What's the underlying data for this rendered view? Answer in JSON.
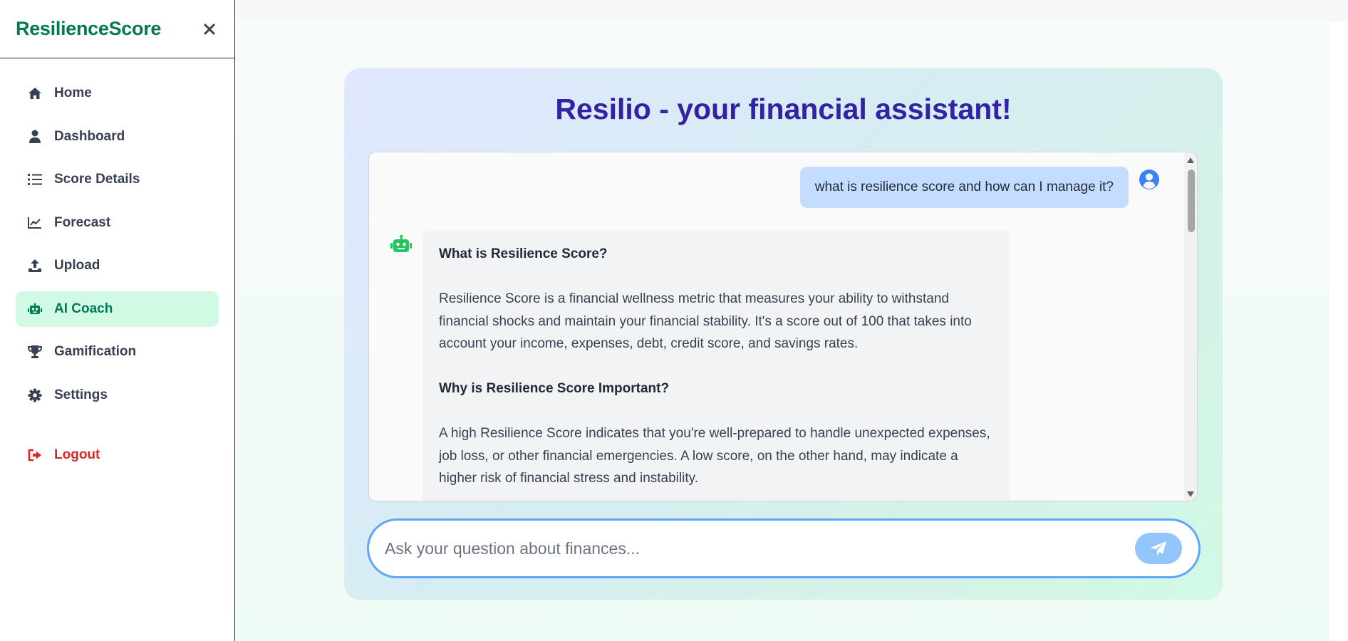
{
  "sidebar": {
    "brand": "ResilienceScore",
    "close_icon": "close-icon",
    "items": [
      {
        "label": "Home",
        "icon": "home-icon"
      },
      {
        "label": "Dashboard",
        "icon": "user-icon"
      },
      {
        "label": "Score Details",
        "icon": "list-icon"
      },
      {
        "label": "Forecast",
        "icon": "line-chart-icon"
      },
      {
        "label": "Upload",
        "icon": "upload-icon"
      },
      {
        "label": "AI Coach",
        "icon": "robot-icon",
        "active": true
      },
      {
        "label": "Gamification",
        "icon": "trophy-icon"
      },
      {
        "label": "Settings",
        "icon": "gear-icon"
      }
    ],
    "logout": {
      "label": "Logout",
      "icon": "logout-icon"
    }
  },
  "chat": {
    "title": "Resilio - your financial assistant!",
    "user_message": "what is resilience score and how can I manage it?",
    "bot_message": {
      "heading1": "What is Resilience Score?",
      "para1": "Resilience Score is a financial wellness metric that measures your ability to withstand financial shocks and maintain your financial stability. It's a score out of 100 that takes into account your income, expenses, debt, credit score, and savings rates.",
      "heading2": "Why is Resilience Score Important?",
      "para2": "A high Resilience Score indicates that you're well-prepared to handle unexpected expenses, job loss, or other financial emergencies. A low score, on the other hand, may indicate a higher risk of financial stress and instability."
    },
    "input_placeholder": "Ask your question about finances...",
    "send_icon": "send-icon"
  },
  "colors": {
    "brand": "#047857",
    "active_bg": "#d1fae5",
    "logout": "#dc2626",
    "title": "#3321a6",
    "user_bubble": "#c4dcfd",
    "bot_bubble": "#f2f3f5",
    "input_border": "#60a5fa",
    "send_button": "#93c5fd",
    "bot_icon": "#22c55e",
    "user_icon": "#3b82f6"
  }
}
